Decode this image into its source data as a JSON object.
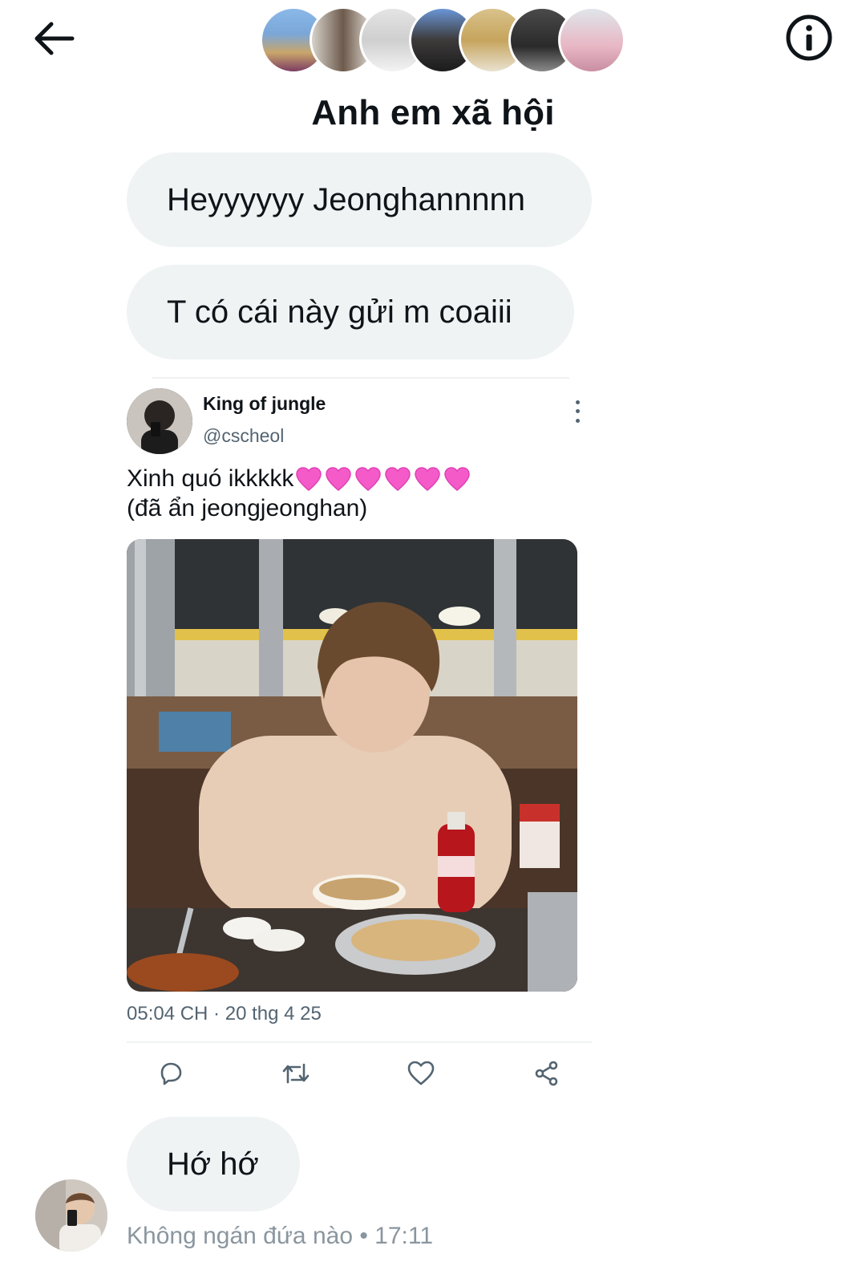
{
  "header": {
    "title": "Anh em xã hội",
    "back_icon": "arrow-left-icon",
    "info_icon": "info-circle-icon",
    "member_avatars": [
      "avatar-1",
      "avatar-2",
      "avatar-3",
      "avatar-4",
      "avatar-5",
      "avatar-6",
      "avatar-7"
    ]
  },
  "messages": {
    "m1": "Heyyyyyy Jeonghannnnn",
    "m2": "T có cái này gửi m coaiii",
    "m3": "Hớ hớ"
  },
  "tweet": {
    "display_name": "King of jungle",
    "handle": "@cscheol",
    "text_line1": "Xinh quó ikkkkk",
    "text_line2": "(đã ẩn jeongjeonghan)",
    "emoji": "pink-heart-icon",
    "timestamp": "05:04 CH · 20 thg 4 25",
    "actions": [
      "reply-icon",
      "retweet-icon",
      "like-icon",
      "share-icon"
    ]
  },
  "meta": {
    "sender_time": "Không ngán đứa nào • 17:11"
  },
  "colors": {
    "bubble": "#eff3f4",
    "text": "#0f1419",
    "secondary": "#536471",
    "heart": "#f45bc9"
  }
}
